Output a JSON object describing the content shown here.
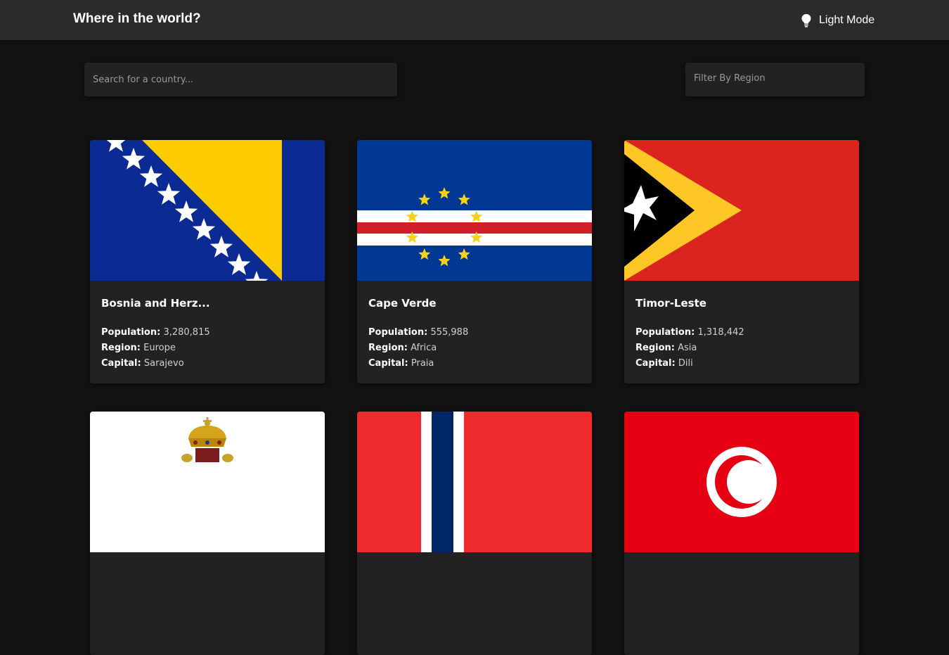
{
  "header": {
    "title": "Where in the world?",
    "mode_toggle_label": "Light Mode",
    "mode_icon": "lightbulb-icon"
  },
  "search": {
    "placeholder": "Search for a country...",
    "value": ""
  },
  "filter": {
    "label": "Filter By Region"
  },
  "labels": {
    "population": "Population:",
    "region": "Region:",
    "capital": "Capital:"
  },
  "countries": [
    {
      "name": "Bosnia and Herz...",
      "population": "3,280,815",
      "region": "Europe",
      "capital": "Sarajevo",
      "flag": "bosnia-flag"
    },
    {
      "name": "Cape Verde",
      "population": "555,988",
      "region": "Africa",
      "capital": "Praia",
      "flag": "cape-verde-flag"
    },
    {
      "name": "Timor-Leste",
      "population": "1,318,442",
      "region": "Asia",
      "capital": "Dili",
      "flag": "timor-leste-flag"
    },
    {
      "flag": "vatican-like-flag"
    },
    {
      "flag": "norway-flag"
    },
    {
      "flag": "tunisia-flag"
    }
  ],
  "colors": {
    "background": "#121212",
    "header": "#2b2b2b",
    "card": "#222222",
    "text": "#ffffff"
  }
}
